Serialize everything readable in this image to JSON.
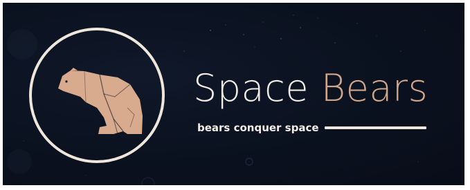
{
  "logo": {
    "brand_word_1": "Space",
    "brand_word_2": "Bears",
    "tagline": "bears conquer space",
    "icon": "polar-bear-icon"
  },
  "colors": {
    "background": "#0b1220",
    "primary_text": "#f2ece6",
    "accent": "#cfa68c",
    "bear_fill": "#d9ab8e",
    "ring": "#efe6dc"
  }
}
